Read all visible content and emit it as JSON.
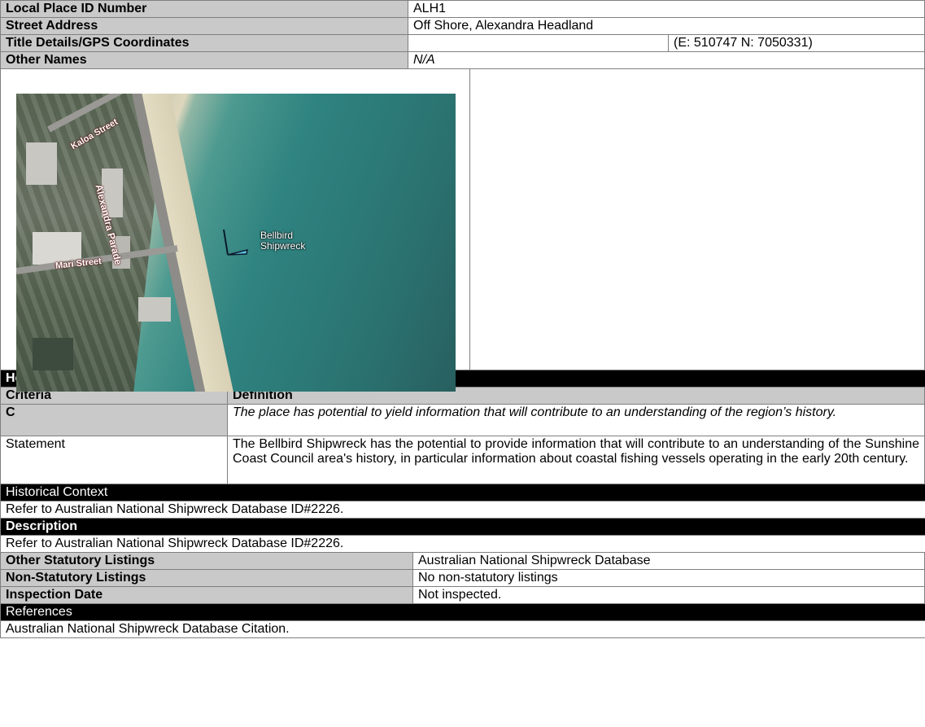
{
  "header": {
    "local_place_id_label": "Local Place ID Number",
    "local_place_id_value": "ALH1",
    "street_address_label": "Street Address",
    "street_address_value": "Off Shore, Alexandra Headland",
    "title_details_label": "Title Details/GPS Coordinates",
    "title_details_value": "",
    "gps_value": "(E: 510747 N: 7050331)",
    "other_names_label": "Other Names",
    "other_names_value": "N/A"
  },
  "map": {
    "street_kaloa": "Kaloa Street",
    "street_alexandra": "Alexandra Parade",
    "street_mari": "Mari Street",
    "poi_line1": "Bellbird",
    "poi_line2": "Shipwreck"
  },
  "significance": {
    "section_title": "Heritage Significance",
    "criteria_header": "Criteria",
    "definition_header": "Definition",
    "criterion_code": "C",
    "criterion_definition": "The place has potential to yield information that will contribute to an understanding of the region’s history.",
    "statement_label": "Statement",
    "statement_text": "The Bellbird Shipwreck has the potential to provide information that will contribute to an understanding of the Sunshine Coast Council area's history, in particular information about coastal fishing vessels operating in the early 20th century."
  },
  "historical_context": {
    "title": "Historical Context",
    "text": "Refer to Australian National Shipwreck Database ID#2226."
  },
  "description": {
    "title": "Description",
    "text": "Refer to Australian National Shipwreck Database ID#2226."
  },
  "listings": {
    "other_statutory_label": "Other Statutory Listings",
    "other_statutory_value": "Australian National Shipwreck Database",
    "non_statutory_label": "Non-Statutory Listings",
    "non_statutory_value": "No non-statutory listings",
    "inspection_label": "Inspection Date",
    "inspection_value": "Not inspected."
  },
  "references": {
    "title": "References",
    "text": "Australian National Shipwreck Database Citation."
  }
}
